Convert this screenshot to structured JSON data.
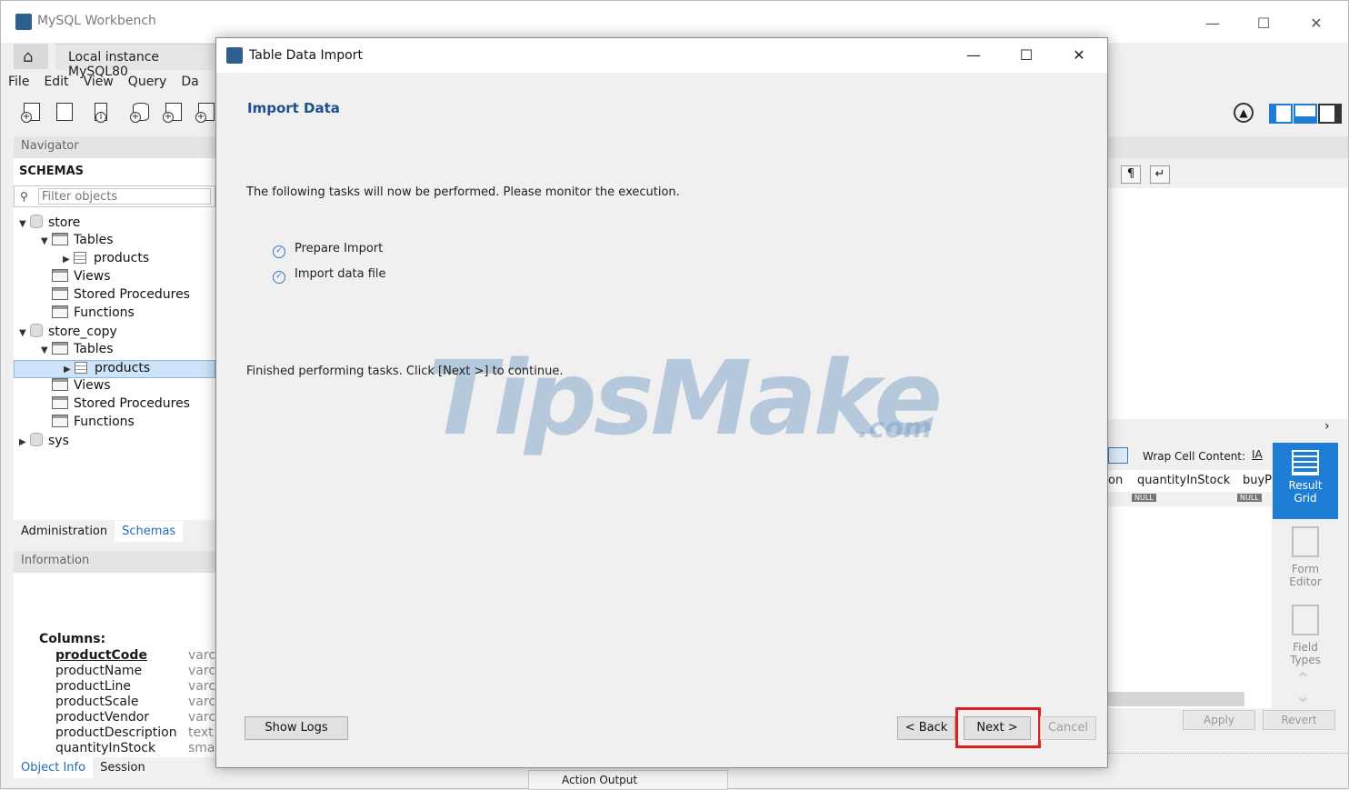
{
  "app": {
    "title": "MySQL Workbench",
    "instance_tab": "Local instance MySQL80",
    "menu": [
      "File",
      "Edit",
      "View",
      "Query",
      "Da"
    ]
  },
  "navigator": {
    "header": "Navigator",
    "schemas_label": "SCHEMAS",
    "filter_placeholder": "Filter objects",
    "tree": [
      {
        "label": "store",
        "kind": "db",
        "level": 0,
        "expanded": true
      },
      {
        "label": "Tables",
        "kind": "folder",
        "level": 1,
        "expanded": true
      },
      {
        "label": "products",
        "kind": "table",
        "level": 2,
        "expanded": false
      },
      {
        "label": "Views",
        "kind": "folder",
        "level": 1
      },
      {
        "label": "Stored Procedures",
        "kind": "folder",
        "level": 1
      },
      {
        "label": "Functions",
        "kind": "folder",
        "level": 1
      },
      {
        "label": "store_copy",
        "kind": "db",
        "level": 0,
        "expanded": true
      },
      {
        "label": "Tables",
        "kind": "folder",
        "level": 1,
        "expanded": true
      },
      {
        "label": "products",
        "kind": "table",
        "level": 2,
        "expanded": false,
        "selected": true
      },
      {
        "label": "Views",
        "kind": "folder",
        "level": 1
      },
      {
        "label": "Stored Procedures",
        "kind": "folder",
        "level": 1
      },
      {
        "label": "Functions",
        "kind": "folder",
        "level": 1
      },
      {
        "label": "sys",
        "kind": "db",
        "level": 0,
        "expanded": false
      }
    ],
    "tabs": [
      "Administration",
      "Schemas"
    ],
    "active_tab": "Schemas"
  },
  "information": {
    "header": "Information",
    "columns_label": "Columns:",
    "columns": [
      {
        "name": "productCode",
        "type": "varcl",
        "primary": true
      },
      {
        "name": "productName",
        "type": "varcl"
      },
      {
        "name": "productLine",
        "type": "varcl"
      },
      {
        "name": "productScale",
        "type": "varcl"
      },
      {
        "name": "productVendor",
        "type": "varcl"
      },
      {
        "name": "productDescription",
        "type": "text"
      },
      {
        "name": "quantityInStock",
        "type": "smal"
      }
    ],
    "tabs": [
      "Object Info",
      "Session"
    ],
    "active_tab": "Object Info"
  },
  "right_panel": {
    "wrap_label": "Wrap Cell Content:",
    "col_partial": "on",
    "col_quantity": "quantityInStock",
    "col_buy": "buyP",
    "null_tag": "NULL",
    "side_tabs": [
      {
        "label_1": "Result",
        "label_2": "Grid",
        "active": true
      },
      {
        "label_1": "Form",
        "label_2": "Editor"
      },
      {
        "label_1": "Field",
        "label_2": "Types"
      }
    ],
    "apply_label": "Apply",
    "revert_label": "Revert",
    "action_output": "Action Output"
  },
  "dialog": {
    "title": "Table Data Import",
    "heading": "Import Data",
    "intro": "The following tasks will now be performed. Please monitor the execution.",
    "tasks": [
      "Prepare Import",
      "Import data file"
    ],
    "finished": "Finished performing tasks. Click [Next >] to continue.",
    "watermark": "TipsMake",
    "watermark_suffix": ".com",
    "show_logs": "Show Logs",
    "back": "< Back",
    "next": "Next >",
    "cancel": "Cancel",
    "highlight_color": "#e01e1e"
  }
}
